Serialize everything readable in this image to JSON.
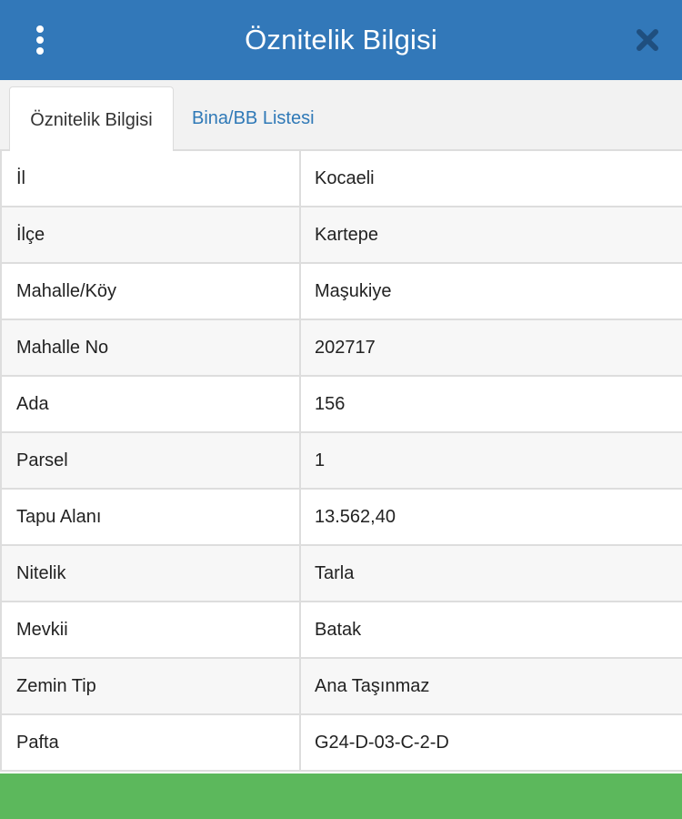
{
  "header": {
    "title": "Öznitelik Bilgisi",
    "color": "#3278b9",
    "menu_icon": "vertical-ellipsis-icon",
    "close_icon": "close-icon"
  },
  "tabs": [
    {
      "label": "Öznitelik Bilgisi",
      "active": true
    },
    {
      "label": "Bina/BB Listesi",
      "active": false
    }
  ],
  "attributes": [
    {
      "key": "İl",
      "value": "Kocaeli"
    },
    {
      "key": "İlçe",
      "value": "Kartepe"
    },
    {
      "key": "Mahalle/Köy",
      "value": "Maşukiye"
    },
    {
      "key": "Mahalle No",
      "value": "202717"
    },
    {
      "key": "Ada",
      "value": "156"
    },
    {
      "key": "Parsel",
      "value": "1"
    },
    {
      "key": "Tapu Alanı",
      "value": "13.562,40"
    },
    {
      "key": "Nitelik",
      "value": "Tarla"
    },
    {
      "key": "Mevkii",
      "value": "Batak"
    },
    {
      "key": "Zemin Tip",
      "value": "Ana Taşınmaz"
    },
    {
      "key": "Pafta",
      "value": "G24-D-03-C-2-D"
    }
  ],
  "footer": {
    "color": "#5cb85c"
  }
}
